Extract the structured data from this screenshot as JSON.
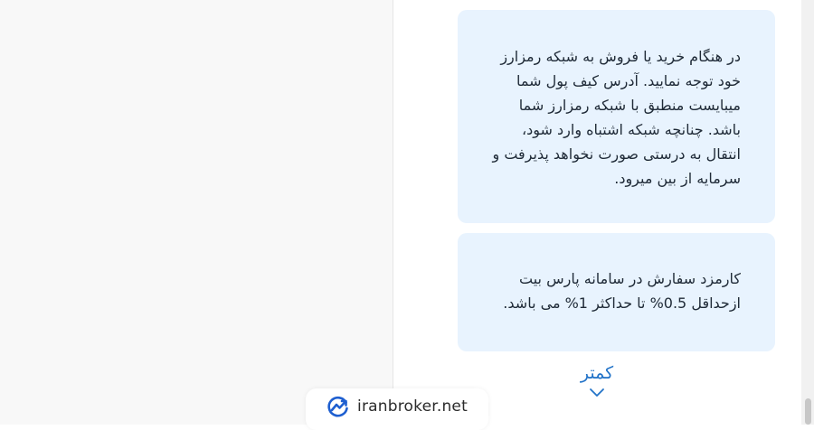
{
  "cards": [
    {
      "text": "در هنگام خرید یا فروش به شبکه رمزارز خود توجه نمایید. آدرس کیف پول شما میبایست منطبق با شبکه رمزارز شما باشد. چنانچه شبکه اشتباه وارد شود، انتقال به درستی صورت نخواهد پذیرفت و سرمایه از بین میرود."
    },
    {
      "text": "کارمزد سفارش در سامانه پارس بیت ازحداقل 0.5% تا حداکثر 1% می باشد."
    }
  ],
  "toggle": {
    "label": "کمتر",
    "icon": "chevron-down-icon"
  },
  "badge": {
    "text": "iranbroker.net",
    "icon": "trend-chart-icon"
  },
  "colors": {
    "card_bg": "#e8f3fe",
    "accent": "#2273c8",
    "logo_blue": "#1e5fd0"
  }
}
